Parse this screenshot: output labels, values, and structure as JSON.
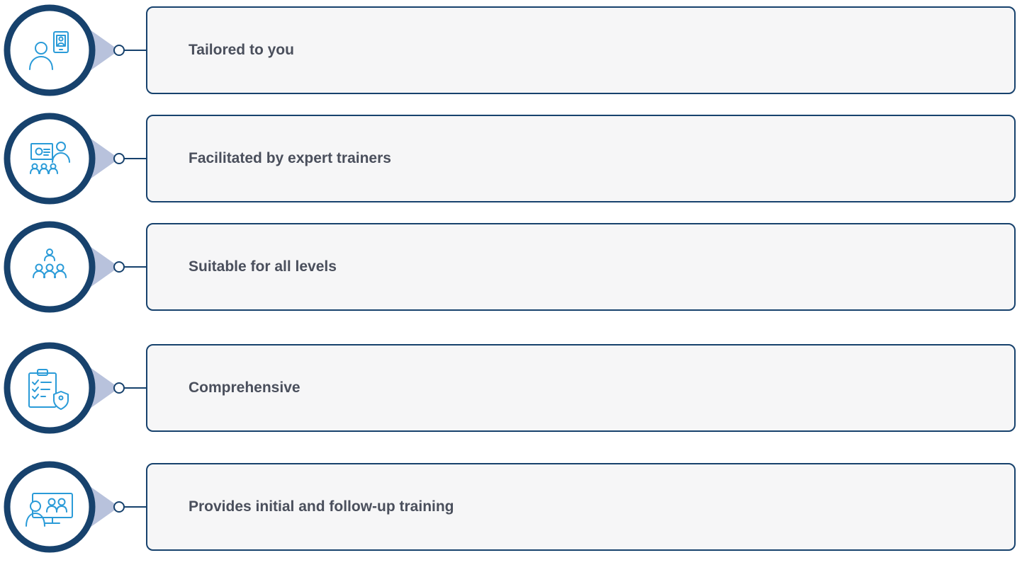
{
  "colors": {
    "ring": "#17426d",
    "wedge": "#b8c2dc",
    "icon": "#2a9bd8",
    "card_border": "#17426d",
    "card_fill": "#f6f6f7",
    "text": "#4a4f5c"
  },
  "items": [
    {
      "label": "Tailored to you",
      "icon": "person-tablet-icon"
    },
    {
      "label": "Facilitated by expert trainers",
      "icon": "trainer-presentation-icon"
    },
    {
      "label": "Suitable for all levels",
      "icon": "group-hierarchy-icon"
    },
    {
      "label": "Comprehensive",
      "icon": "clipboard-checklist-shield-icon"
    },
    {
      "label": "Provides initial and follow-up training",
      "icon": "group-board-icon"
    }
  ]
}
